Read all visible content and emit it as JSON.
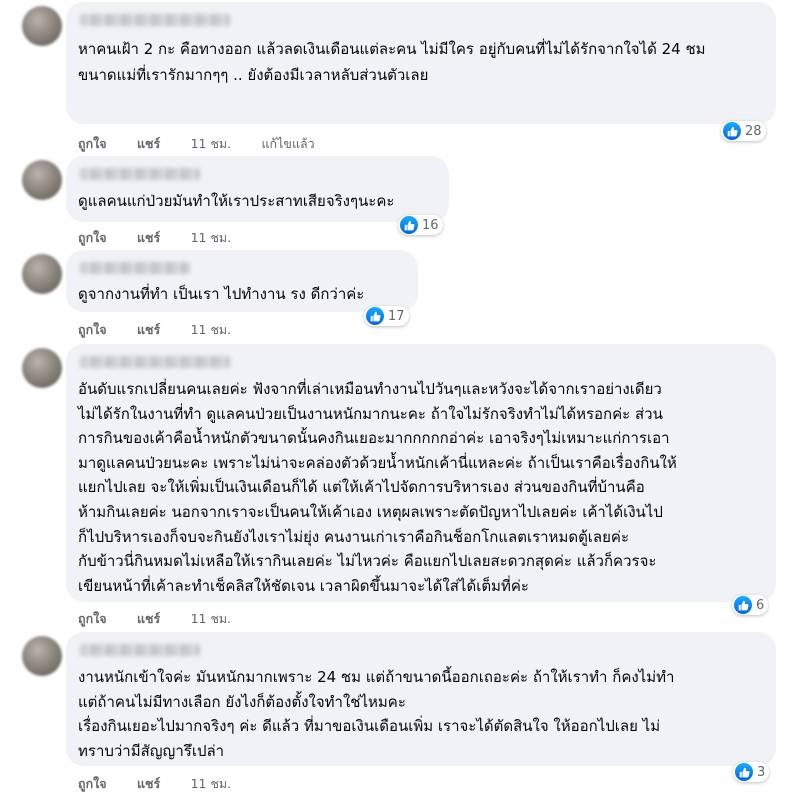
{
  "actions": {
    "like_label": "ถูกใจ",
    "share_label": "แชร์"
  },
  "comments": [
    {
      "text": "หาคนเฝ้า 2 กะ คือทางออก แล้วลดเงินเดือนแต่ละคน ไม่มีใคร อยู่กับคนที่ไม่ได้รักจากใจได้ 24 ชม\nขนาดแม่ที่เรารักมากๆๆ .. ยังต้องมีเวลาหลับส่วนตัวเลย",
      "time": "11 ชม.",
      "edited": "แก้ไขแล้ว",
      "reactions": "28"
    },
    {
      "text": "ดูแลคนแก่ป่วยมันทำให้เราประสาทเสียจริงๆนะคะ",
      "time": "11 ชม.",
      "reactions": "16"
    },
    {
      "text": "ดูจากงานที่ทำ เป็นเรา ไปทำงาน รง ดีกว่าค่ะ",
      "time": "11 ชม.",
      "reactions": "17"
    },
    {
      "text": "อันดับแรกเปลี่ยนคนเลยค่ะ ฟังจากที่เล่าเหมือนทำงานไปวันๆและหวังจะได้จากเราอย่างเดียว\nไม่ได้รักในงานที่ทำ ดูแลคนป่วยเป็นงานหนักมากนะคะ ถ้าใจไม่รักจริงทำไม่ได้หรอกค่ะ ส่วน\nการกินของเค้าคือน้ำหนักตัวขนาดนั้นคงกินเยอะมากกกกกอ่าค่ะ เอาจริงๆไม่เหมาะแก่การเอา\nมาดูแลคนป่วยนะคะ เพราะไม่น่าจะคล่องตัวด้วยน้ำหนักเค้านี่แหละค่ะ ถ้าเป็นเราคือเรื่องกินให้\nแยกไปเลย จะให้เพิ่มเป็นเงินเดือนก็ได้ แต่ให้เค้าไปจัดการบริหารเอง ส่วนของกินที่บ้านคือ\nห้ามกินเลยค่ะ นอกจากเราจะเป็นคนให้เค้าเอง เหตุผลเพราะตัดปัญหาไปเลยค่ะ เค้าได้เงินไป\nก็ไปบริหารเองก็จบจะกินยังไงเราไม่ยุ่ง คนงานเก่าเราคือกินช็อกโกแลตเราหมดตู้เลยค่ะ\nกับข้าวนี่กินหมดไม่เหลือให้เรากินเลยค่ะ ไม่ไหวค่ะ คือแยกไปเลยสะดวกสุดค่ะ แล้วก็ควรจะ\nเขียนหน้าที่เค้าละทำเช็คลิสให้ชัดเจน เวลาผิดขึ้นมาจะได้ใส่ได้เต็มที่ค่ะ",
      "time": "11 ชม.",
      "reactions": "6"
    },
    {
      "text": "งานหนักเข้าใจค่ะ มันหนักมากเพราะ 24 ชม แต่ถ้าขนาดนี้ออกเถอะค่ะ ถ้าให้เราทำ ก็คงไม่ทำ\nแต่ถ้าคนไม่มีทางเลือก ยังไงก็ต้องตั้งใจทำใช่ไหมคะ\nเรื่องกินเยอะไปมากจริงๆ ค่ะ ดีแล้ว ที่มาขอเงินเดือนเพิ่ม เราจะได้ตัดสินใจ ให้ออกไปเลย ไม่\nทราบว่ามีสัญญารึเปล่า",
      "time": "11 ชม.",
      "reactions": "3"
    }
  ]
}
